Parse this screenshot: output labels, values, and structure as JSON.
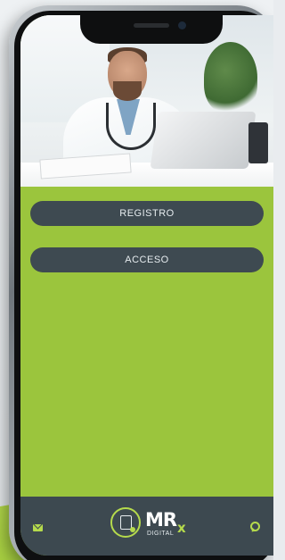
{
  "menu": {
    "registro_label": "REGISTRO",
    "acceso_label": "ACCESO"
  },
  "footer": {
    "brand_mark": "MR",
    "brand_x": "x",
    "brand_sub": "DIGITAL",
    "left_icon": "mail-icon",
    "right_icon": "whatsapp-icon"
  },
  "colors": {
    "accent": "#9bc53d",
    "bar": "#3d4950",
    "button": "#3e4a51",
    "logo_green": "#b5da4c"
  }
}
